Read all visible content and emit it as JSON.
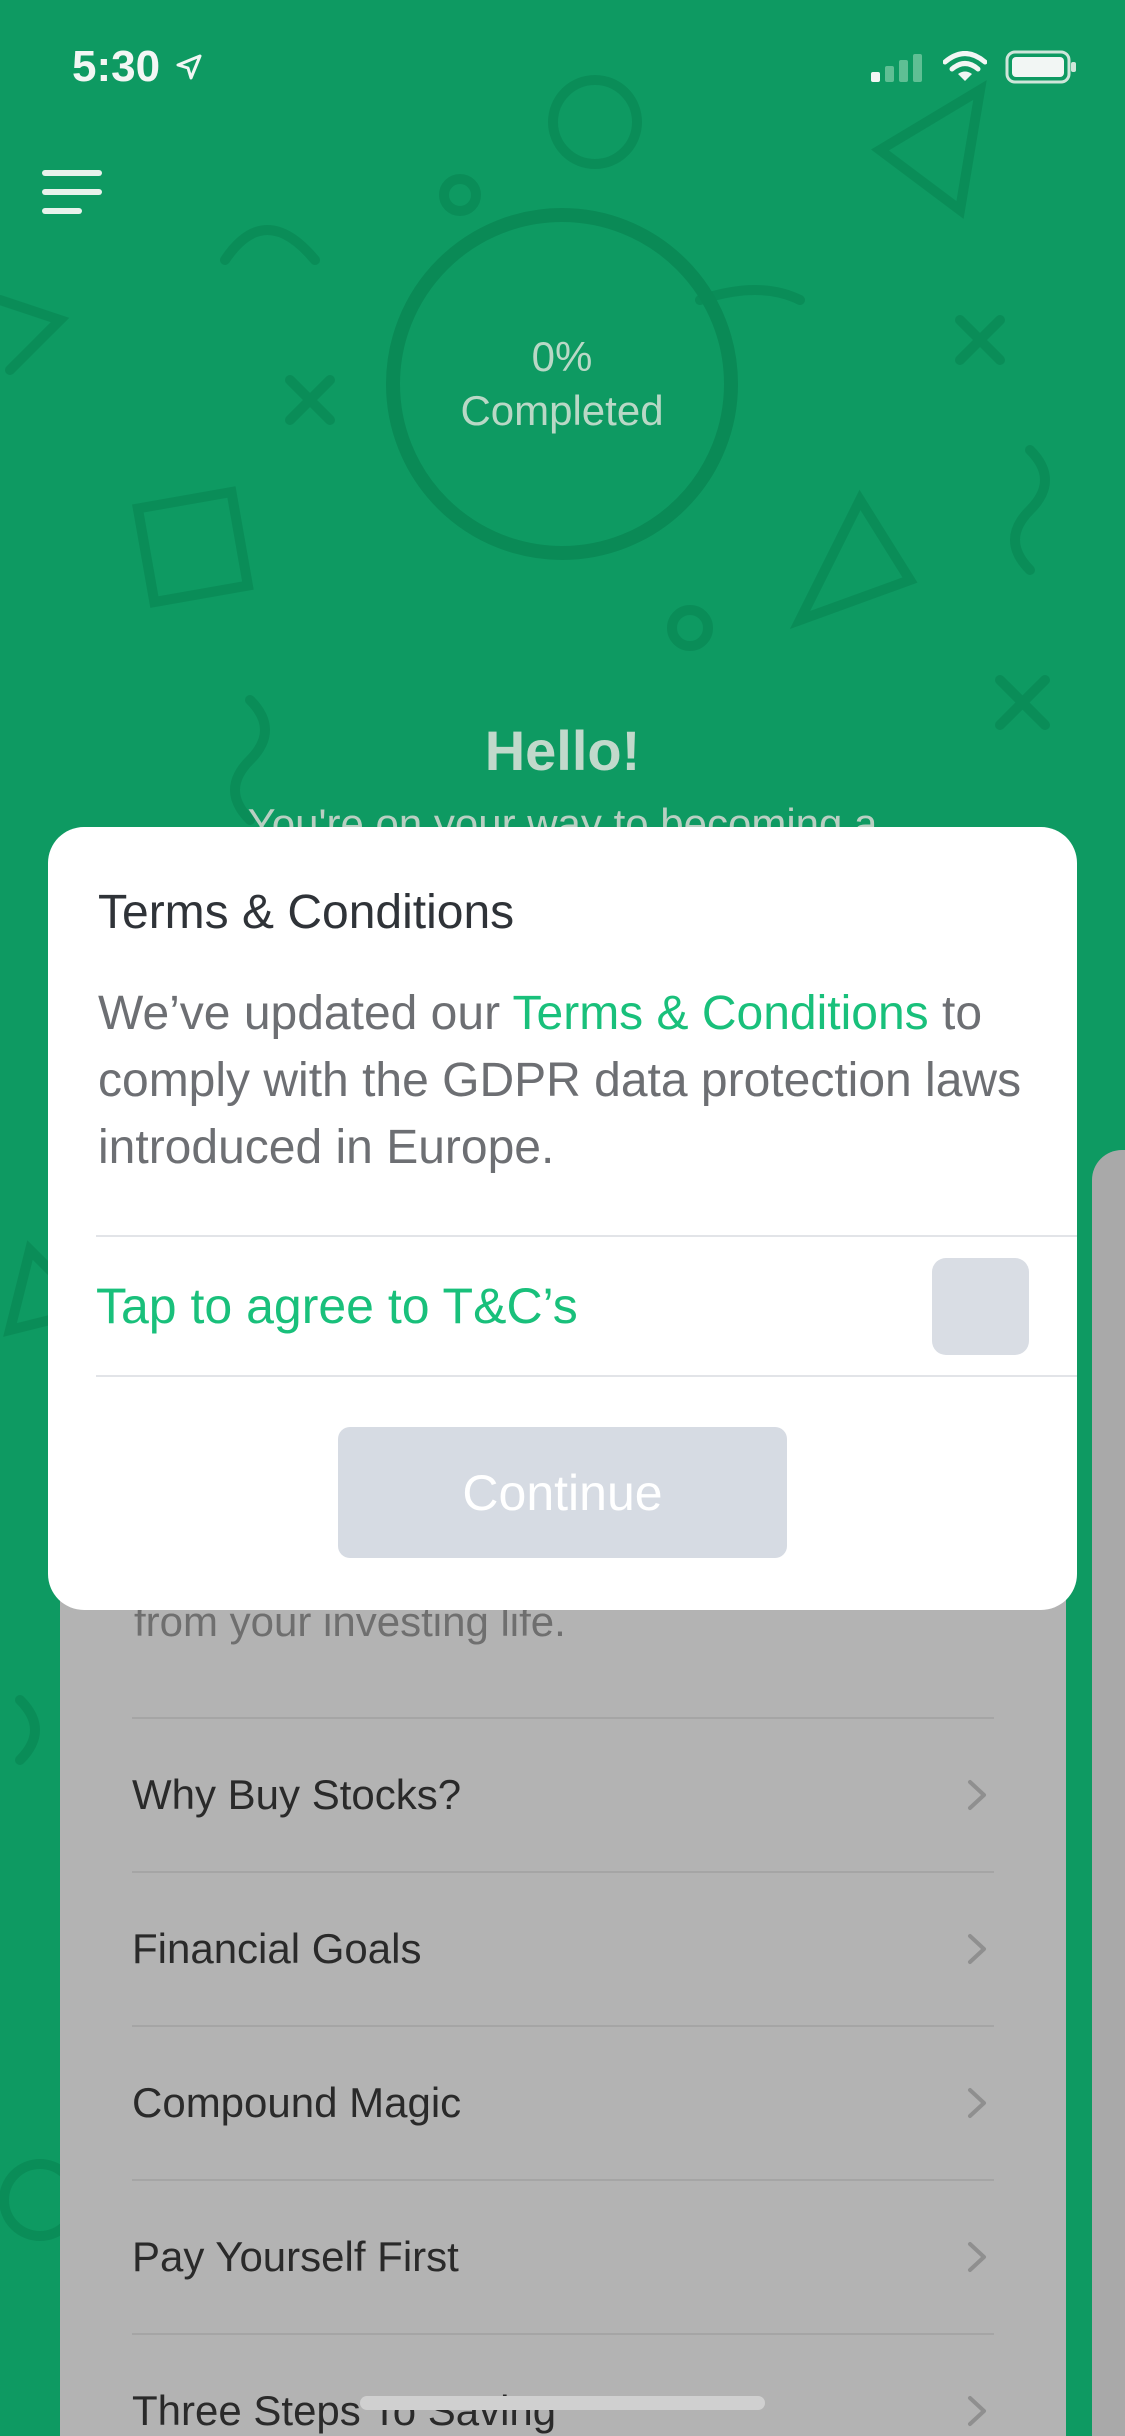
{
  "status_bar": {
    "time": "5:30",
    "icons": [
      "location-arrow-icon",
      "signal-icon",
      "wifi-icon",
      "battery-icon"
    ]
  },
  "header": {
    "menu_icon": "hamburger-menu-icon"
  },
  "progress": {
    "percent_text": "0%",
    "label": "Completed",
    "value": 0
  },
  "greeting": {
    "title": "Hello!",
    "subtitle": "You're on your way to becoming a"
  },
  "sheet": {
    "intro": "from your investing life.",
    "items": [
      {
        "label": "Why Buy Stocks?"
      },
      {
        "label": "Financial Goals"
      },
      {
        "label": "Compound Magic"
      },
      {
        "label": "Pay Yourself First"
      },
      {
        "label": "Three Steps To Saving"
      }
    ]
  },
  "modal": {
    "title": "Terms & Conditions",
    "body_prefix": "We’ve updated our ",
    "body_link": "Terms & Conditions",
    "body_suffix": " to comply with the GDPR data protection laws introduced in Europe.",
    "agree_label": "Tap to agree to T&C’s",
    "agree_checked": false,
    "continue_label": "Continue"
  },
  "colors": {
    "background": "#0e9a62",
    "accent": "#19c07b",
    "disabled": "#d6dbe3"
  }
}
